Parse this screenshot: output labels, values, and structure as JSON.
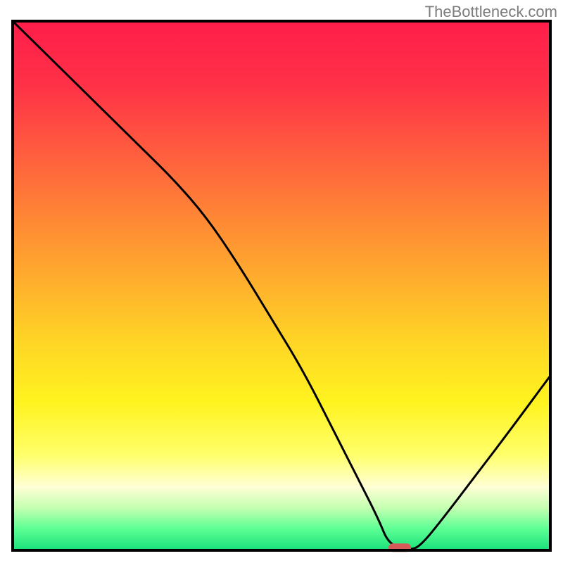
{
  "watermark": "TheBottleneck.com",
  "chart_data": {
    "type": "line",
    "title": "",
    "xlabel": "",
    "ylabel": "",
    "xlim": [
      0,
      100
    ],
    "ylim": [
      0,
      100
    ],
    "background": {
      "style": "vertical-gradient",
      "stops": [
        {
          "offset": 0.0,
          "color": "#ff1d4a"
        },
        {
          "offset": 0.12,
          "color": "#ff3147"
        },
        {
          "offset": 0.24,
          "color": "#ff5a3f"
        },
        {
          "offset": 0.36,
          "color": "#ff8336"
        },
        {
          "offset": 0.48,
          "color": "#ffab2e"
        },
        {
          "offset": 0.6,
          "color": "#ffd326"
        },
        {
          "offset": 0.72,
          "color": "#fff31f"
        },
        {
          "offset": 0.82,
          "color": "#ffff6b"
        },
        {
          "offset": 0.88,
          "color": "#ffffd6"
        },
        {
          "offset": 0.92,
          "color": "#c3ffb0"
        },
        {
          "offset": 0.96,
          "color": "#5bff94"
        },
        {
          "offset": 1.0,
          "color": "#19e07a"
        }
      ]
    },
    "series": [
      {
        "name": "bottleneck-curve",
        "color": "#000000",
        "x": [
          0,
          6,
          12,
          18,
          24,
          30,
          36,
          42,
          48,
          54,
          60,
          64,
          68,
          70,
          74,
          76,
          80,
          86,
          92,
          100
        ],
        "y": [
          100,
          94,
          88,
          82,
          76,
          70,
          63,
          54,
          44,
          34,
          22,
          14,
          6,
          1,
          0,
          1,
          6,
          14,
          22,
          33
        ]
      }
    ],
    "marker": {
      "name": "optimum-marker",
      "x": 72,
      "y": 0.5,
      "color": "#d65a57",
      "shape": "rounded-rect"
    },
    "frame": {
      "color": "#000000",
      "width": 4
    }
  }
}
